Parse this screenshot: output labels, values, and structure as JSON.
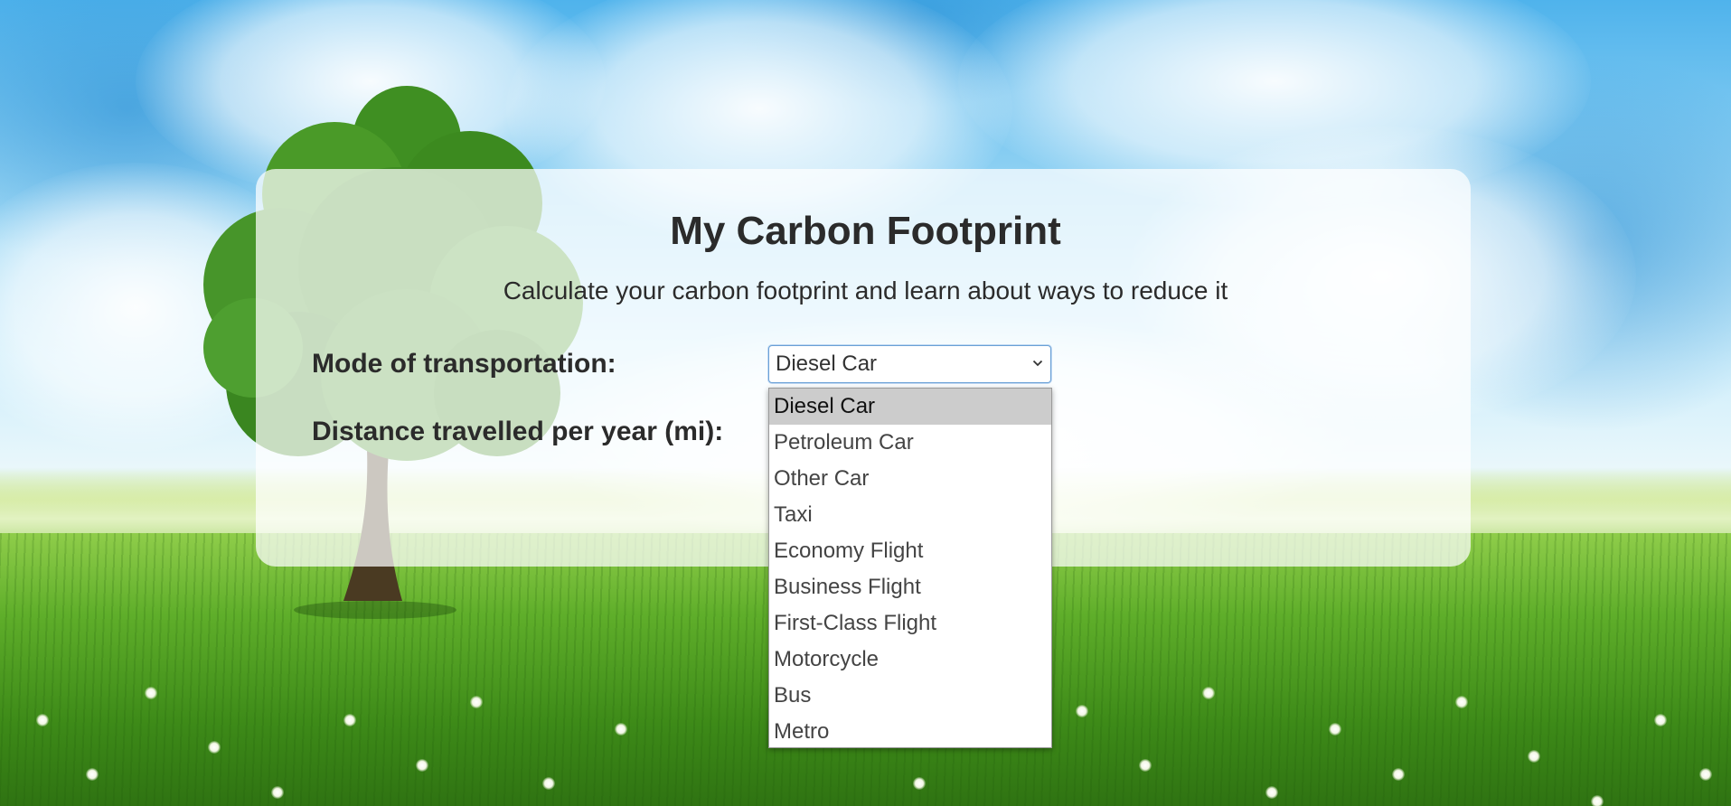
{
  "page": {
    "title": "My Carbon Footprint",
    "subtitle": "Calculate your carbon footprint and learn about ways to reduce it"
  },
  "form": {
    "transport_label": "Mode of transportation:",
    "distance_label": "Distance travelled per year (mi):",
    "transport_select": {
      "value": "Diesel Car",
      "expanded": true,
      "options": [
        "Diesel Car",
        "Petroleum Car",
        "Other Car",
        "Taxi",
        "Economy Flight",
        "Business Flight",
        "First-Class Flight",
        "Motorcycle",
        "Bus",
        "Metro"
      ],
      "highlighted_option": "Diesel Car"
    }
  },
  "theme": {
    "text_color": "#2b2b2b",
    "card_background": "rgba(255,255,255,0.72)",
    "select_focus_border": "#6aa0d6",
    "highlight_background": "#cccccc"
  },
  "icons": {
    "select_arrow": "chevron-down-icon"
  }
}
